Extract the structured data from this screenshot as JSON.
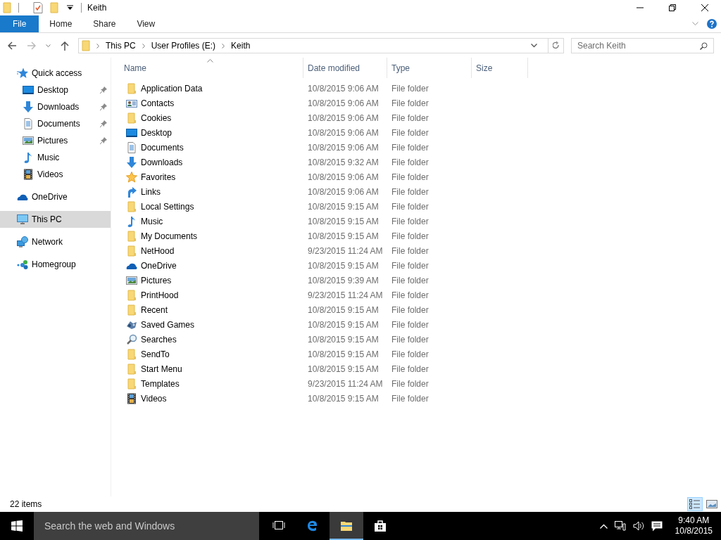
{
  "window": {
    "title": "Keith"
  },
  "ribbon": {
    "tabs": [
      {
        "label": "File",
        "kind": "file"
      },
      {
        "label": "Home",
        "kind": "tab"
      },
      {
        "label": "Share",
        "kind": "tab"
      },
      {
        "label": "View",
        "kind": "tab"
      }
    ]
  },
  "address_bar": {
    "path": [
      "This PC",
      "User Profiles (E:)",
      "Keith"
    ],
    "search": {
      "placeholder": "Search Keith"
    }
  },
  "sidebar": {
    "items": [
      {
        "label": "Quick access",
        "kind": "star",
        "selected": false,
        "children": [
          {
            "label": "Desktop",
            "kind": "desktop",
            "pinned": true,
            "selected": false
          },
          {
            "label": "Downloads",
            "kind": "downloads",
            "pinned": true,
            "selected": false
          },
          {
            "label": "Documents",
            "kind": "documents",
            "pinned": true,
            "selected": false
          },
          {
            "label": "Pictures",
            "kind": "pictures",
            "pinned": true,
            "selected": false
          },
          {
            "label": "Music",
            "kind": "music",
            "pinned": false,
            "selected": false
          },
          {
            "label": "Videos",
            "kind": "videos",
            "pinned": false,
            "selected": false
          }
        ]
      },
      {
        "label": "OneDrive",
        "kind": "onedrive",
        "selected": false
      },
      {
        "label": "This PC",
        "kind": "pc",
        "selected": true
      },
      {
        "label": "Network",
        "kind": "network",
        "selected": false
      },
      {
        "label": "Homegroup",
        "kind": "homegroup",
        "selected": false
      }
    ]
  },
  "table": {
    "columns": [
      {
        "label": "Name",
        "sorted": true
      },
      {
        "label": "Date modified",
        "sorted": false
      },
      {
        "label": "Type",
        "sorted": false
      },
      {
        "label": "Size",
        "sorted": false
      }
    ],
    "rows": [
      {
        "name": "Application Data",
        "kind": "folder",
        "date": "10/8/2015 9:06 AM",
        "type": "File folder"
      },
      {
        "name": "Contacts",
        "kind": "contacts",
        "date": "10/8/2015 9:06 AM",
        "type": "File folder"
      },
      {
        "name": "Cookies",
        "kind": "folder",
        "date": "10/8/2015 9:06 AM",
        "type": "File folder"
      },
      {
        "name": "Desktop",
        "kind": "desktop",
        "date": "10/8/2015 9:06 AM",
        "type": "File folder"
      },
      {
        "name": "Documents",
        "kind": "documents",
        "date": "10/8/2015 9:06 AM",
        "type": "File folder"
      },
      {
        "name": "Downloads",
        "kind": "downloads",
        "date": "10/8/2015 9:32 AM",
        "type": "File folder"
      },
      {
        "name": "Favorites",
        "kind": "favorites",
        "date": "10/8/2015 9:06 AM",
        "type": "File folder"
      },
      {
        "name": "Links",
        "kind": "links",
        "date": "10/8/2015 9:06 AM",
        "type": "File folder"
      },
      {
        "name": "Local Settings",
        "kind": "folder",
        "date": "10/8/2015 9:15 AM",
        "type": "File folder"
      },
      {
        "name": "Music",
        "kind": "music",
        "date": "10/8/2015 9:15 AM",
        "type": "File folder"
      },
      {
        "name": "My Documents",
        "kind": "folder",
        "date": "10/8/2015 9:15 AM",
        "type": "File folder"
      },
      {
        "name": "NetHood",
        "kind": "folder",
        "date": "9/23/2015 11:24 AM",
        "type": "File folder"
      },
      {
        "name": "OneDrive",
        "kind": "onedrive",
        "date": "10/8/2015 9:15 AM",
        "type": "File folder"
      },
      {
        "name": "Pictures",
        "kind": "pictures",
        "date": "10/8/2015 9:39 AM",
        "type": "File folder"
      },
      {
        "name": "PrintHood",
        "kind": "folder",
        "date": "9/23/2015 11:24 AM",
        "type": "File folder"
      },
      {
        "name": "Recent",
        "kind": "folder",
        "date": "10/8/2015 9:15 AM",
        "type": "File folder"
      },
      {
        "name": "Saved Games",
        "kind": "games",
        "date": "10/8/2015 9:15 AM",
        "type": "File folder"
      },
      {
        "name": "Searches",
        "kind": "searches",
        "date": "10/8/2015 9:15 AM",
        "type": "File folder"
      },
      {
        "name": "SendTo",
        "kind": "folder",
        "date": "10/8/2015 9:15 AM",
        "type": "File folder"
      },
      {
        "name": "Start Menu",
        "kind": "folder",
        "date": "10/8/2015 9:15 AM",
        "type": "File folder"
      },
      {
        "name": "Templates",
        "kind": "folder",
        "date": "9/23/2015 11:24 AM",
        "type": "File folder"
      },
      {
        "name": "Videos",
        "kind": "videos",
        "date": "10/8/2015 9:15 AM",
        "type": "File folder"
      }
    ]
  },
  "status_bar": {
    "count": "22 items",
    "views": [
      {
        "kind": "details",
        "selected": true
      },
      {
        "kind": "large",
        "selected": false
      }
    ]
  },
  "taskbar": {
    "search": {
      "placeholder": "Search the web and Windows"
    },
    "apps": [
      {
        "kind": "taskview",
        "selected": false
      },
      {
        "kind": "edge",
        "selected": false
      },
      {
        "kind": "explorer",
        "selected": true
      },
      {
        "kind": "store",
        "selected": false
      }
    ],
    "time": "9:40 AM",
    "date": "10/8/2015"
  }
}
